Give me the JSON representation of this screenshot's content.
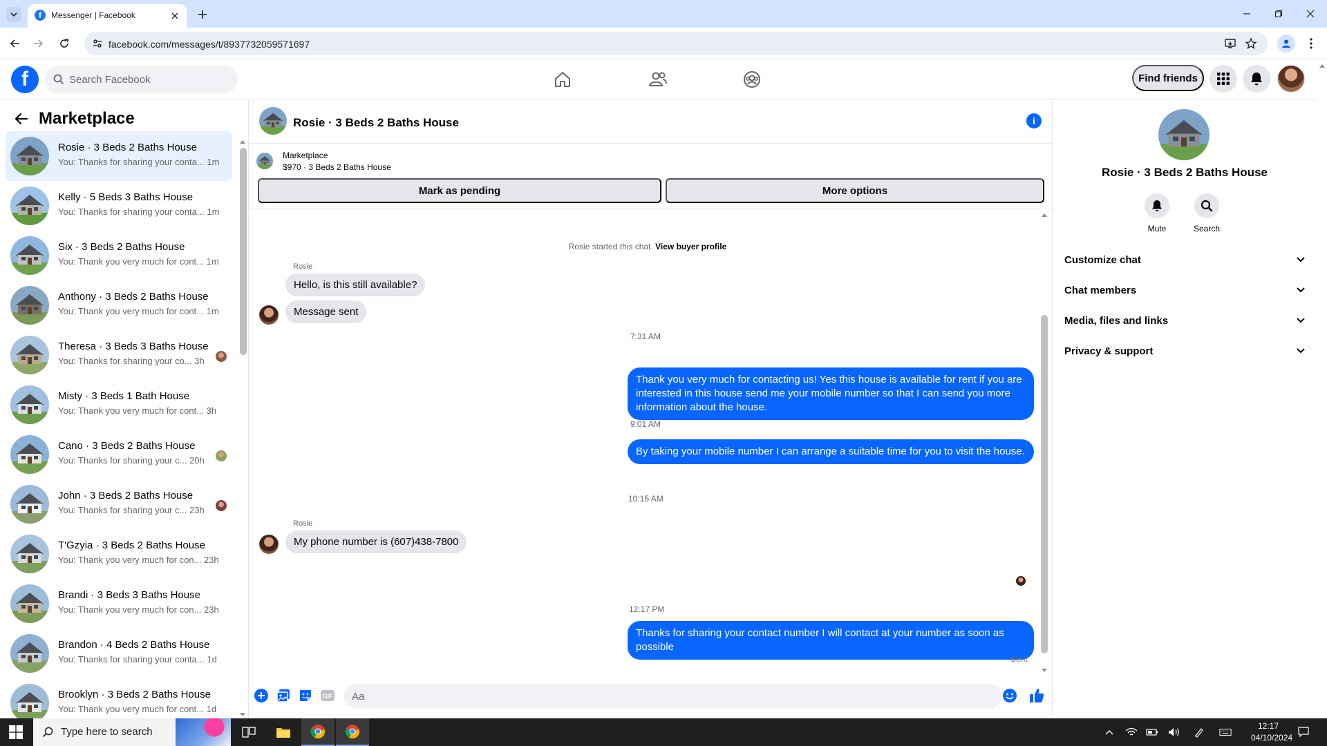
{
  "browser": {
    "tab_title": "Messenger | Facebook",
    "url": "facebook.com/messages/t/8937732059571697"
  },
  "header": {
    "search_placeholder": "Search Facebook",
    "find_friends": "Find friends"
  },
  "sidebar": {
    "title": "Marketplace",
    "conversations": [
      {
        "name": "Rosie · 3 Beds 2 Baths House",
        "preview": "You: Thanks for sharing your conta...",
        "time": "1m",
        "active": true
      },
      {
        "name": "Kelly · 5 Beds 3 Baths House",
        "preview": "You: Thanks for sharing your conta...",
        "time": "1m"
      },
      {
        "name": "Six · 3 Beds 2 Baths House",
        "preview": "You: Thank you very much for cont...",
        "time": "1m"
      },
      {
        "name": "Anthony · 3 Beds 2 Baths House",
        "preview": "You: Thank you very much for cont...",
        "time": "1m"
      },
      {
        "name": "Theresa · 3 Beds 3 Baths House",
        "preview": "You: Thanks for sharing your co...",
        "time": "3h"
      },
      {
        "name": "Misty · 3 Beds 1 Bath House",
        "preview": "You: Thank you very much for cont...",
        "time": "3h"
      },
      {
        "name": "Cano · 3 Beds 2 Baths House",
        "preview": "You: Thanks for sharing your c...",
        "time": "20h"
      },
      {
        "name": "John · 3 Beds 2 Baths House",
        "preview": "You: Thanks for sharing your c...",
        "time": "23h"
      },
      {
        "name": "T'Gzyia · 3 Beds 2 Baths House",
        "preview": "You: Thank you very much for con...",
        "time": "23h"
      },
      {
        "name": "Brandi · 3 Beds 3 Baths House",
        "preview": "You: Thank you very much for con...",
        "time": "23h"
      },
      {
        "name": "Brandon · 4 Beds 2 Baths House",
        "preview": "You: Thanks for sharing your conta...",
        "time": "1d"
      },
      {
        "name": "Brooklyn · 3 Beds 2 Baths House",
        "preview": "You: Thank you very much for cont...",
        "time": "1d"
      }
    ]
  },
  "chat": {
    "title": "Rosie · 3 Beds 2 Baths House",
    "listing_label": "Marketplace",
    "listing_price": "$970 · 3 Beds 2 Baths House",
    "mark_pending": "Mark as pending",
    "more_options": "More options",
    "started_text": "Rosie started this chat.",
    "view_profile": "View buyer profile",
    "sender": "Rosie",
    "in_msg_1": "Hello, is this still available?",
    "in_msg_2": "Message sent",
    "time_1": "7:31 AM",
    "out_msg_1": "Thank you very much for contacting us! Yes this house is available for rent if you are interested in this house send me your mobile number so that I can send you more information about the house.",
    "time_2": "9:01 AM",
    "out_msg_2": "By taking your mobile number I can arrange a suitable time for you to visit the house.",
    "time_3": "10:15 AM",
    "in_msg_3": "My phone number is (607)438-7800",
    "time_4": "12:17 PM",
    "out_msg_3": "Thanks for sharing your contact number I will contact at your number as soon as possible",
    "sent_label": "Sent",
    "input_placeholder": "Aa"
  },
  "info_panel": {
    "title": "Rosie · 3 Beds 2 Baths House",
    "mute": "Mute",
    "search": "Search",
    "sections": [
      "Customize chat",
      "Chat members",
      "Media, files and links",
      "Privacy & support"
    ]
  },
  "taskbar": {
    "search_placeholder": "Type here to search",
    "time": "12:17",
    "date": "04/10/2024"
  },
  "colors": {
    "accent": "#0866ff",
    "active_row": "#e6f0fe",
    "bubble_in": "#e4e6eb"
  }
}
